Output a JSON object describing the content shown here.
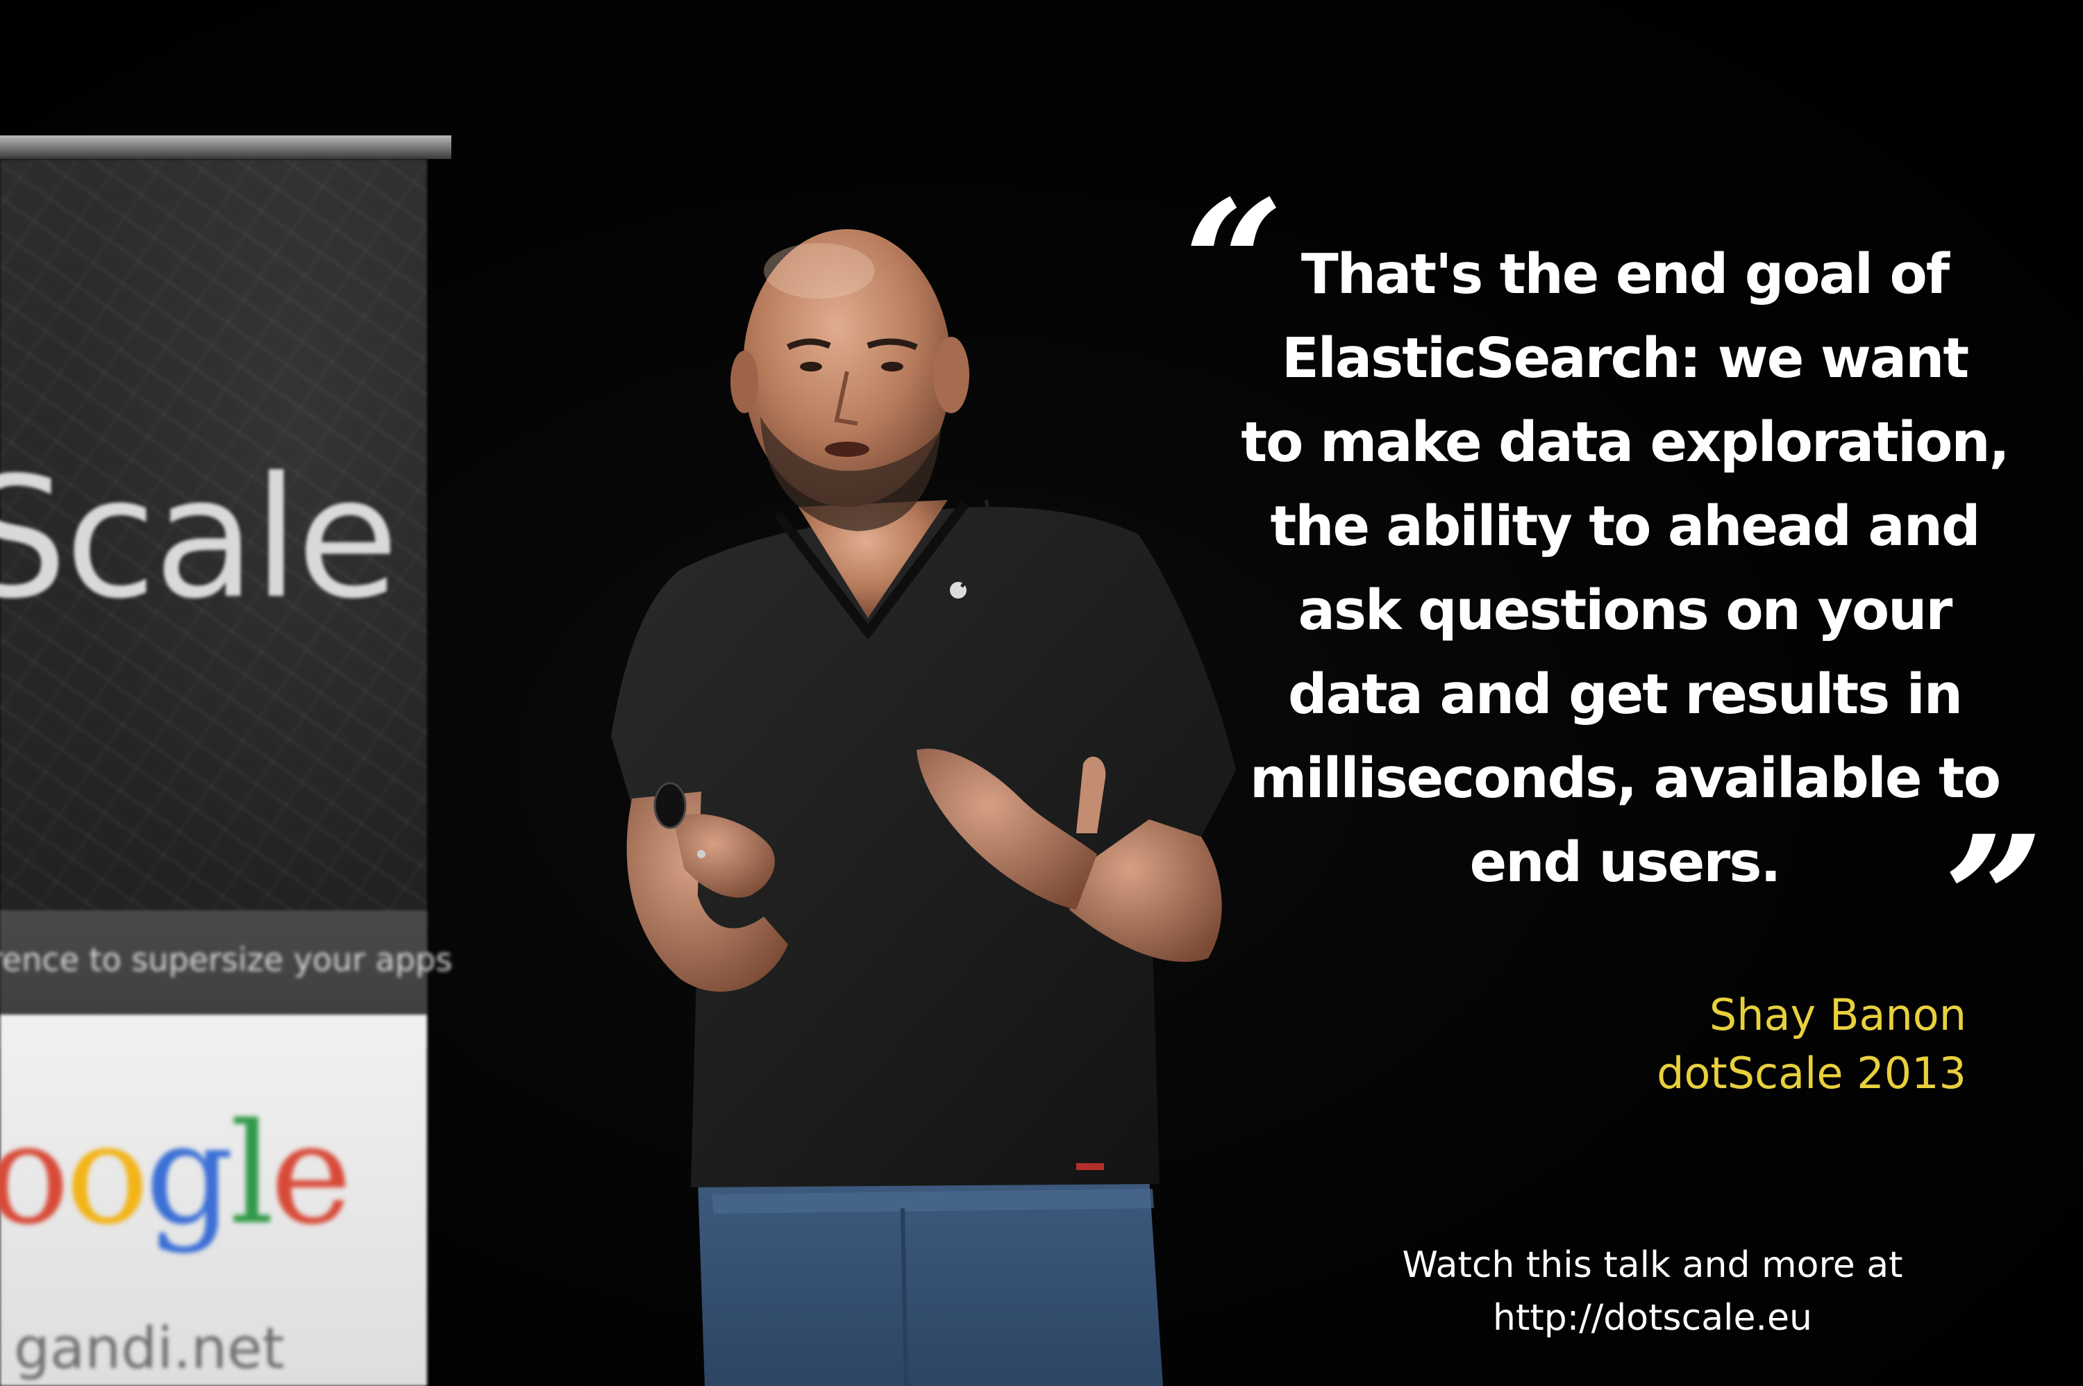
{
  "banner": {
    "title": "Scale",
    "tagline": "rence to supersize your apps",
    "google_letters": [
      {
        "ch": "o",
        "color": "#d84a38"
      },
      {
        "ch": "o",
        "color": "#f2b417"
      },
      {
        "ch": "g",
        "color": "#3b6fd6"
      },
      {
        "ch": "l",
        "color": "#2f9a48"
      },
      {
        "ch": "e",
        "color": "#d84a38"
      }
    ],
    "sponsor": "gandi.net"
  },
  "quote": {
    "lines": [
      "That's the end goal of",
      "ElasticSearch: we want",
      "to make data exploration,",
      "the ability to ahead and",
      "ask questions on your",
      "data and get results in",
      "milliseconds, available to",
      "end users."
    ],
    "open_mark": "“",
    "close_mark": "”"
  },
  "attribution": {
    "speaker": "Shay Banon",
    "event": "dotScale 2013",
    "color": "#e8d03d"
  },
  "footer": {
    "line1": "Watch this talk and more at",
    "line2": "http://dotscale.eu"
  }
}
